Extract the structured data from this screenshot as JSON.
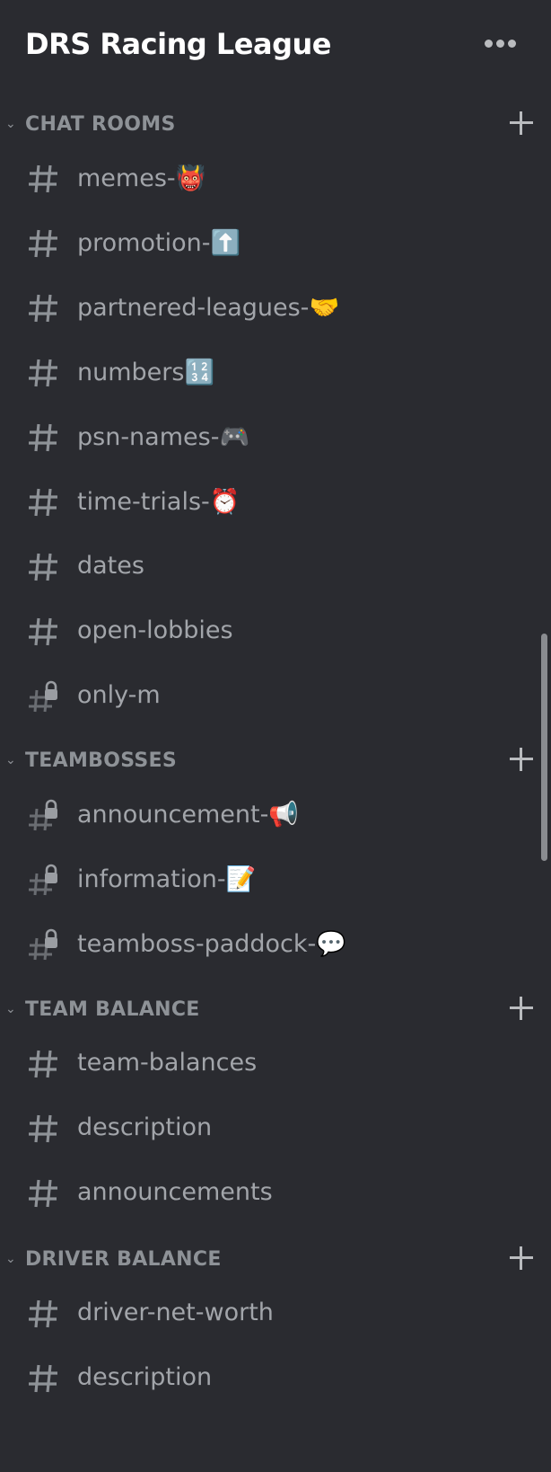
{
  "header": {
    "title": "DRS Racing League",
    "more_icon": "more-horizontal-icon"
  },
  "colors": {
    "background": "#2a2b30",
    "title": "#ffffff",
    "category": "#8e9297",
    "channel": "#a2a5aa"
  },
  "categories": [
    {
      "label": "CHAT ROOMS",
      "channels": [
        {
          "name": "memes-",
          "emoji": "👹",
          "locked": false
        },
        {
          "name": "promotion-",
          "emoji": "⬆️",
          "locked": false
        },
        {
          "name": "partnered-leagues-",
          "emoji": "🤝",
          "locked": false
        },
        {
          "name": "numbers",
          "emoji": "🔢",
          "locked": false
        },
        {
          "name": "psn-names-",
          "emoji": "🎮",
          "locked": false
        },
        {
          "name": "time-trials-",
          "emoji": "⏰",
          "locked": false
        },
        {
          "name": "dates",
          "emoji": "",
          "locked": false
        },
        {
          "name": "open-lobbies",
          "emoji": "",
          "locked": false
        },
        {
          "name": "only-m",
          "emoji": "",
          "locked": true
        }
      ]
    },
    {
      "label": "TEAMBOSSES",
      "channels": [
        {
          "name": "announcement-",
          "emoji": "📢",
          "locked": true
        },
        {
          "name": "information-",
          "emoji": "📝",
          "locked": true
        },
        {
          "name": "teamboss-paddock-",
          "emoji": "💬",
          "locked": true
        }
      ]
    },
    {
      "label": "TEAM BALANCE",
      "channels": [
        {
          "name": "team-balances",
          "emoji": "",
          "locked": false
        },
        {
          "name": "description",
          "emoji": "",
          "locked": false
        },
        {
          "name": "announcements",
          "emoji": "",
          "locked": false
        }
      ]
    },
    {
      "label": "DRIVER BALANCE",
      "channels": [
        {
          "name": "driver-net-worth",
          "emoji": "",
          "locked": false
        },
        {
          "name": "description",
          "emoji": "",
          "locked": false
        }
      ]
    }
  ]
}
